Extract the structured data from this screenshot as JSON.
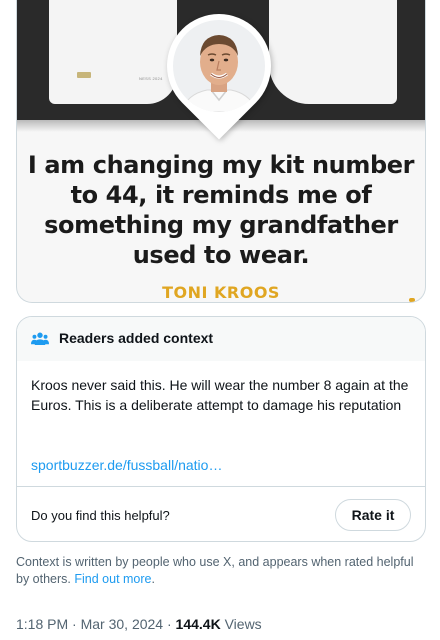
{
  "image": {
    "quote": "I am changing my kit number to 44, it reminds me of something my grandfather used to wear.",
    "author": "TONI KROOS",
    "shirt_sponsor": "NESS 2024"
  },
  "note": {
    "title": "Readers added context",
    "body": "Kroos never said this. He will wear the number 8 again at the Euros. This is a deliberate attempt to damage his reputation",
    "link": "sportbuzzer.de/fussball/natio…",
    "helpful_question": "Do you find this helpful?",
    "rate_label": "Rate it",
    "header_icon": "people-icon",
    "header_icon_color": "#1d9bf0"
  },
  "footer": {
    "context_text": "Context is written by people who use X, and appears when rated helpful by others.",
    "learn_more": "Find out more",
    "period": "."
  },
  "meta": {
    "time": "1:18 PM",
    "separator": "·",
    "date": "Mar 30, 2024",
    "views_count": "144.4K",
    "views_label": "Views"
  },
  "colors": {
    "accent": "#1d9bf0",
    "author_gold": "#e0a622",
    "text_secondary": "#536471"
  }
}
